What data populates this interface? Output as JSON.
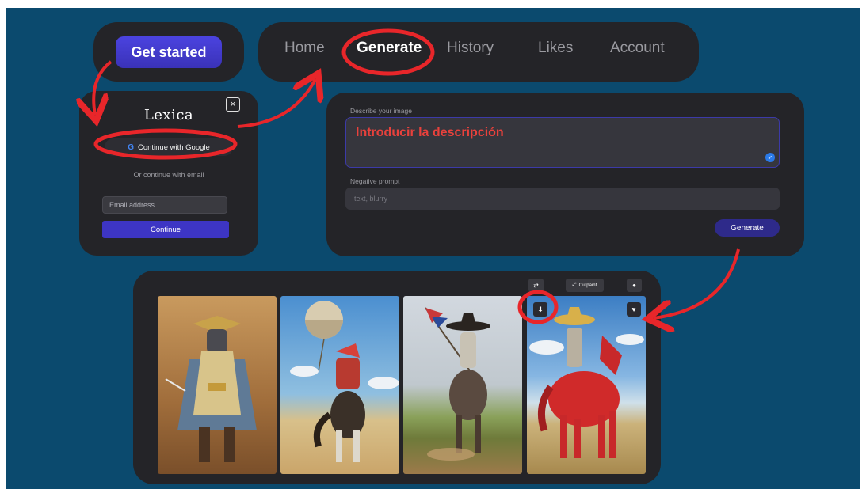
{
  "get_started": {
    "label": "Get started"
  },
  "nav": {
    "home": "Home",
    "generate": "Generate",
    "history": "History",
    "likes": "Likes",
    "account": "Account"
  },
  "login": {
    "logo": "Lexica",
    "close_icon": "×",
    "google_icon": "G",
    "google_label": "Continue with Google",
    "or_text": "Or continue with email",
    "email_placeholder": "Email address",
    "continue_label": "Continue"
  },
  "generate_form": {
    "describe_label": "Describe your image",
    "prompt_text": "Introducir la descripción",
    "negative_label": "Negative prompt",
    "negative_placeholder": "text, blurry",
    "generate_label": "Generate"
  },
  "gallery": {
    "outpaint_label": "Outpaint",
    "images": [
      {
        "icon": "knight-figure-image"
      },
      {
        "icon": "rider-with-balloon-image"
      },
      {
        "icon": "knight-with-lance-on-horse-image"
      },
      {
        "icon": "knight-on-red-horse-image"
      }
    ]
  },
  "colors": {
    "background": "#0b4a6e",
    "panel": "#242428",
    "accent": "#3d35c4",
    "annotation": "#e8262a"
  }
}
